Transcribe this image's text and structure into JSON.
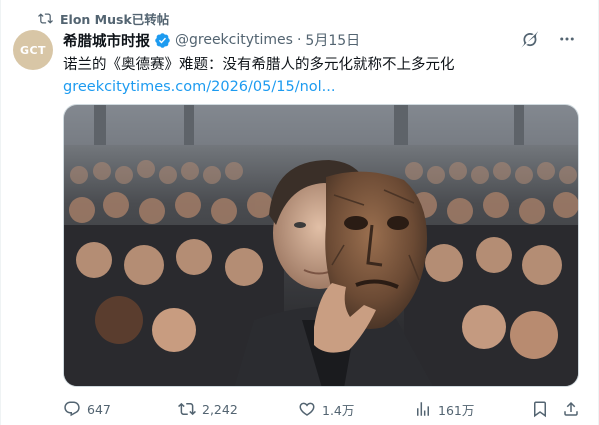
{
  "repost_banner": {
    "text": "Elon Musk已转帖"
  },
  "author": {
    "name": "希腊城市时报",
    "handle": "@greekcitytimes",
    "separator": "·",
    "time": "5月15日",
    "avatar_text": "GCT"
  },
  "tweet": {
    "text": "诺兰的《奥德赛》难题：没有希腊人的多元化就称不上多元化",
    "link": "greekcitytimes.com/2026/05/15/nol..."
  },
  "media": {
    "icon": "photo-of-man-holding-stone-mask-in-crowd"
  },
  "actions": {
    "replies": "647",
    "reposts": "2,242",
    "likes": "1.4万",
    "views": "161万"
  },
  "colors": {
    "accent": "#1d9bf0",
    "secondary_text": "#536471",
    "primary_text": "#0f1419",
    "verified": "#1d9bf0"
  }
}
